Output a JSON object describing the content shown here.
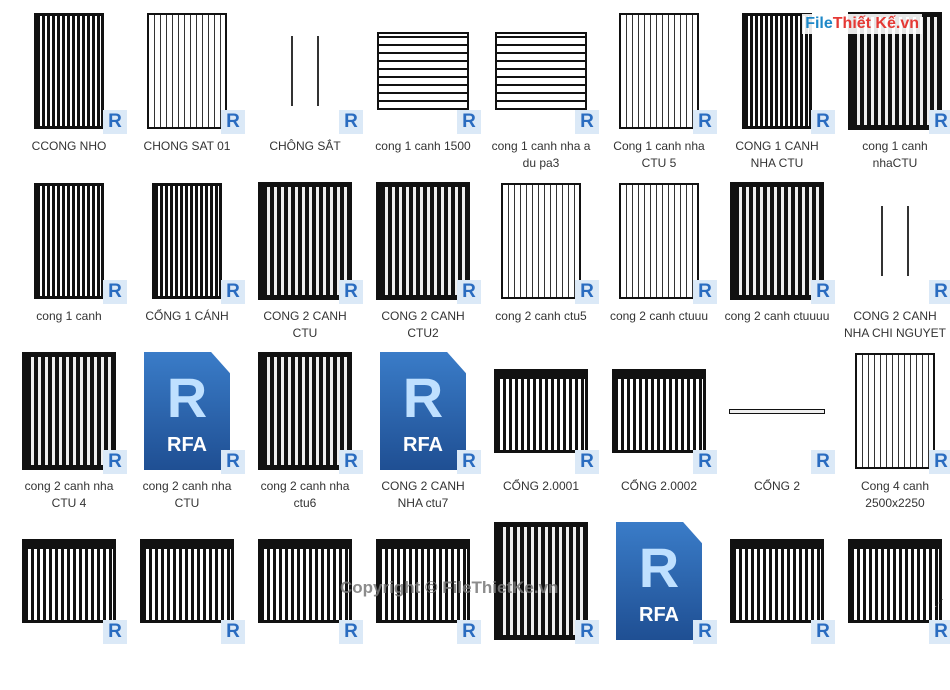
{
  "logo": {
    "text": "File",
    "accent": "Thiết Kế.vn"
  },
  "watermark": "Copyright © FileThietKe.vn",
  "badge_letter": "R",
  "rfa_label": "RFA",
  "items": [
    {
      "label": "CCONG NHO",
      "thumb": "g-dark"
    },
    {
      "label": "CHONG SAT 01",
      "thumb": "g-out"
    },
    {
      "label": "CHÔNG SẮT",
      "thumb": "g-thin"
    },
    {
      "label": "cong 1 canh 1500",
      "thumb": "g-panel"
    },
    {
      "label": "cong 1 canh nha a du pa3",
      "thumb": "g-panel"
    },
    {
      "label": "Cong 1 canh nha CTU 5",
      "thumb": "g-out"
    },
    {
      "label": "CONG 1 CANH NHA CTU",
      "thumb": "g-dark"
    },
    {
      "label": "cong 1 canh nhaCTU",
      "thumb": "g-wide"
    },
    {
      "label": "cong 1 canh",
      "thumb": "g-dark"
    },
    {
      "label": "CỔNG 1 CÁNH",
      "thumb": "g-dark"
    },
    {
      "label": "CONG 2 CANH CTU",
      "thumb": "g-wide"
    },
    {
      "label": "CONG 2 CANH CTU2",
      "thumb": "g-wide"
    },
    {
      "label": "cong 2 canh ctu5",
      "thumb": "g-out"
    },
    {
      "label": "cong 2 canh ctuuu",
      "thumb": "g-out"
    },
    {
      "label": "cong 2 canh ctuuuu",
      "thumb": "g-wide"
    },
    {
      "label": "CONG 2 CANH NHA CHI NGUYET",
      "thumb": "g-thin"
    },
    {
      "label": "cong 2 canh nha CTU 4",
      "thumb": "g-wide"
    },
    {
      "label": "cong 2 canh nha CTU",
      "thumb": "rfa"
    },
    {
      "label": "cong 2 canh nha ctu6",
      "thumb": "g-wide"
    },
    {
      "label": "CONG 2 CANH NHA ctu7",
      "thumb": "rfa"
    },
    {
      "label": "CỔNG 2.0001",
      "thumb": "g-arch"
    },
    {
      "label": "CỔNG 2.0002",
      "thumb": "g-arch"
    },
    {
      "label": "CỔNG 2",
      "thumb": "g-bar"
    },
    {
      "label": "Cong 4 canh 2500x2250",
      "thumb": "g-out"
    },
    {
      "label": "",
      "thumb": "g-arch"
    },
    {
      "label": "",
      "thumb": "g-arch"
    },
    {
      "label": "",
      "thumb": "g-arch"
    },
    {
      "label": "",
      "thumb": "g-arch"
    },
    {
      "label": "",
      "thumb": "g-wide"
    },
    {
      "label": "",
      "thumb": "rfa"
    },
    {
      "label": "",
      "thumb": "g-arch"
    },
    {
      "label": "",
      "thumb": "g-arch"
    }
  ]
}
